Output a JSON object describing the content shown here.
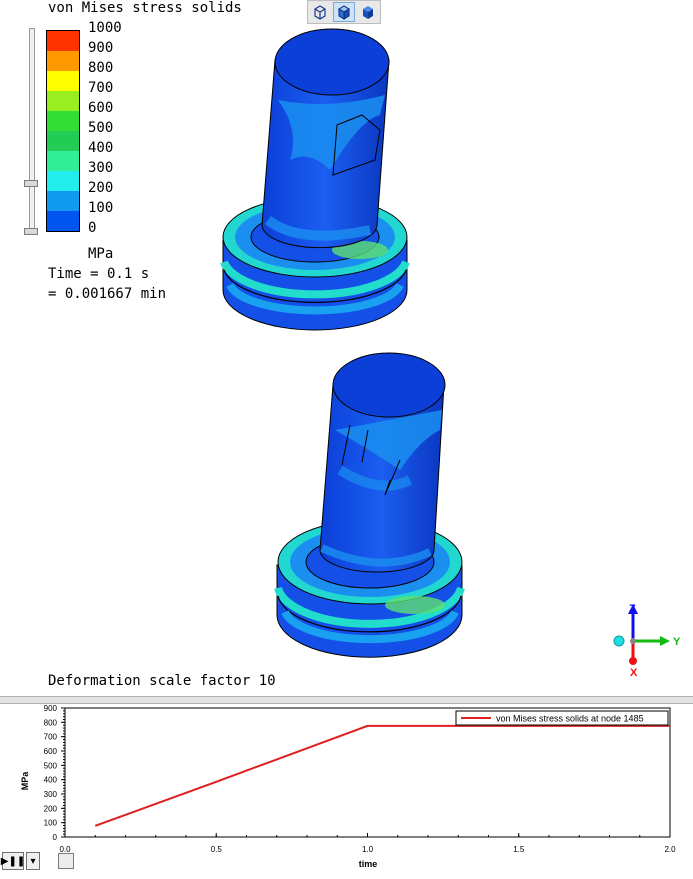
{
  "viewport": {
    "title": "von Mises stress solids",
    "unit": "MPa",
    "time_line1": "Time = 0.1 s",
    "time_line2": "= 0.001667 min",
    "deformation_label": "Deformation scale factor 10",
    "view_toolbar": [
      "wireframe-view-icon",
      "shaded-edges-view-icon",
      "shaded-view-icon"
    ],
    "axis_triad": {
      "z": "Z",
      "y": "Y",
      "x": "X"
    }
  },
  "legend": {
    "labels": [
      "1000",
      "900",
      "800",
      "700",
      "600",
      "500",
      "400",
      "300",
      "200",
      "100",
      "0"
    ],
    "colors": [
      "#ff3300",
      "#ff9900",
      "#ffff00",
      "#99ee22",
      "#33dd33",
      "#22cc55",
      "#33ee99",
      "#22eeee",
      "#1199ee",
      "#0055ee"
    ]
  },
  "plot": {
    "ylabel": "MPa",
    "xlabel": "time",
    "legend_label": "von Mises stress solids at node 1485",
    "line_color": "#e02020"
  },
  "chart_data": {
    "type": "line",
    "xlabel": "time",
    "ylabel": "MPa",
    "xlim": [
      0.0,
      2.0
    ],
    "ylim": [
      0,
      900
    ],
    "x_ticks": [
      "0.0",
      "0.5",
      "1.0",
      "1.5",
      "2.0"
    ],
    "y_ticks": [
      "0",
      "100",
      "200",
      "300",
      "400",
      "500",
      "600",
      "700",
      "800",
      "900"
    ],
    "legend_position": "top-right",
    "series": [
      {
        "name": "von Mises stress solids at node 1485",
        "x": [
          0.1,
          0.5,
          1.0,
          2.0
        ],
        "y": [
          78,
          385,
          775,
          775
        ]
      }
    ]
  },
  "controls": {
    "play_pause": "▶❚❚",
    "dropdown": "▾"
  }
}
